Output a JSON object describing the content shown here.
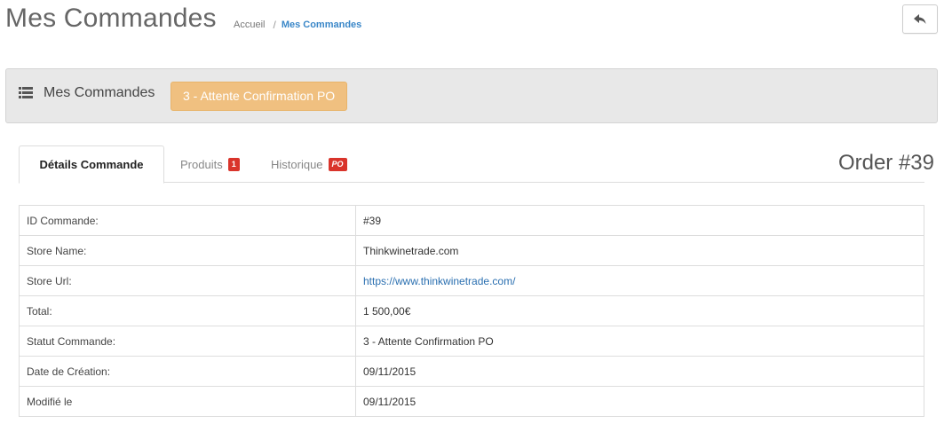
{
  "header": {
    "title": "Mes Commandes",
    "breadcrumb": {
      "home": "Accueil",
      "separator": "/",
      "current": "Mes Commandes"
    },
    "back_icon": "reply-arrow-icon"
  },
  "panel": {
    "icon": "list-icon",
    "title": "Mes Commandes",
    "status": "3 - Attente Confirmation PO",
    "status_color": "#f0c080"
  },
  "tabs": [
    {
      "label": "Détails Commande",
      "active": true
    },
    {
      "label": "Produits",
      "badge": "1"
    },
    {
      "label": "Historique",
      "badge": "PO"
    }
  ],
  "order_title": "Order #39",
  "details": [
    {
      "label": "ID Commande:",
      "value": "#39"
    },
    {
      "label": "Store Name:",
      "value": "Thinkwinetrade.com"
    },
    {
      "label": "Store Url:",
      "value": "https://www.thinkwinetrade.com/"
    },
    {
      "label": "Total:",
      "value": "1 500,00€"
    },
    {
      "label": "Statut Commande:",
      "value": "3 - Attente Confirmation PO"
    },
    {
      "label": "Date de Création:",
      "value": "09/11/2015"
    },
    {
      "label": "Modifié le",
      "value": "09/11/2015"
    }
  ],
  "colors": {
    "accent_link": "#2a6fb0",
    "badge_red": "#d9342b"
  }
}
